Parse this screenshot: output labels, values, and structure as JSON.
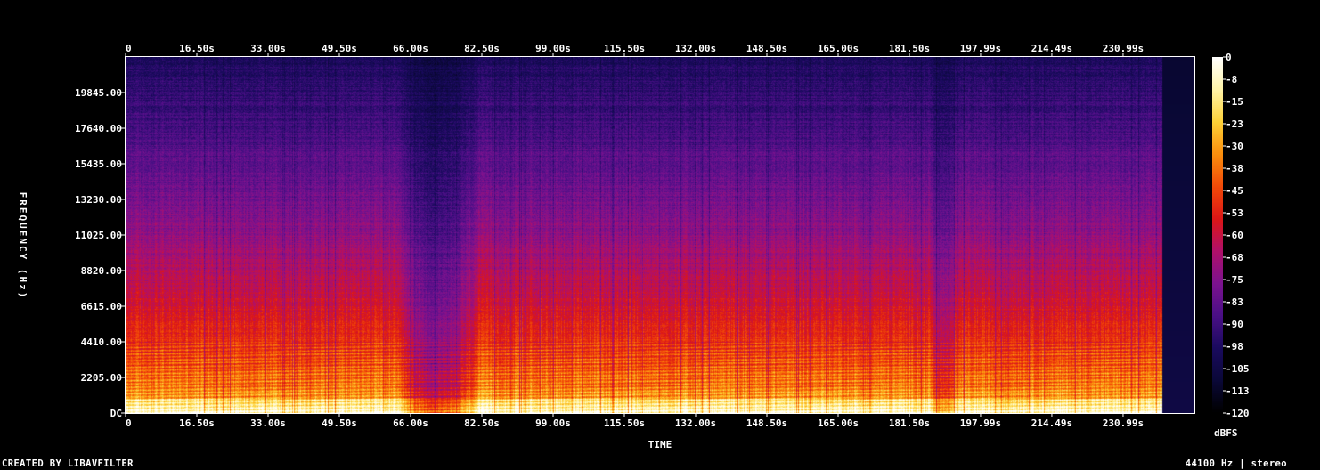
{
  "chart_data": {
    "type": "heatmap",
    "title": "",
    "xlabel": "TIME",
    "ylabel": "FREQUENCY (Hz)",
    "x_ticks": [
      "0",
      "16.50s",
      "33.00s",
      "49.50s",
      "66.00s",
      "82.50s",
      "99.00s",
      "115.50s",
      "132.00s",
      "148.50s",
      "165.00s",
      "181.50s",
      "197.99s",
      "214.49s",
      "230.99s"
    ],
    "x_tick_values": [
      0,
      16.5,
      33.0,
      49.5,
      66.0,
      82.5,
      99.0,
      115.5,
      132.0,
      148.5,
      165.0,
      181.5,
      197.99,
      214.49,
      230.99
    ],
    "xlim": [
      0,
      247.5
    ],
    "y_ticks": [
      "DC",
      "2205.00",
      "4410.00",
      "6615.00",
      "8820.00",
      "11025.00",
      "13230.00",
      "15435.00",
      "17640.00",
      "19845.00"
    ],
    "y_tick_values": [
      0,
      2205,
      4410,
      6615,
      8820,
      11025,
      13230,
      15435,
      17640,
      19845
    ],
    "ylim": [
      0,
      22050
    ],
    "audio_end": 240,
    "colorbar": {
      "label": "dBFS",
      "ticks": [
        "0",
        "-8",
        "-15",
        "-23",
        "-30",
        "-38",
        "-45",
        "-53",
        "-60",
        "-68",
        "-75",
        "-83",
        "-90",
        "-98",
        "-105",
        "-113",
        "-120"
      ],
      "range": [
        -120,
        0
      ]
    },
    "colors": [
      "#000000",
      "#0a0838",
      "#1a0a5e",
      "#4a0f86",
      "#7c128f",
      "#b0106a",
      "#dc1616",
      "#f24a08",
      "#fb8e0d",
      "#fdd137",
      "#fff4a8",
      "#ffffff"
    ]
  },
  "footer": {
    "credit": "CREATED BY LIBAVFILTER",
    "info": "44100 Hz | stereo"
  }
}
